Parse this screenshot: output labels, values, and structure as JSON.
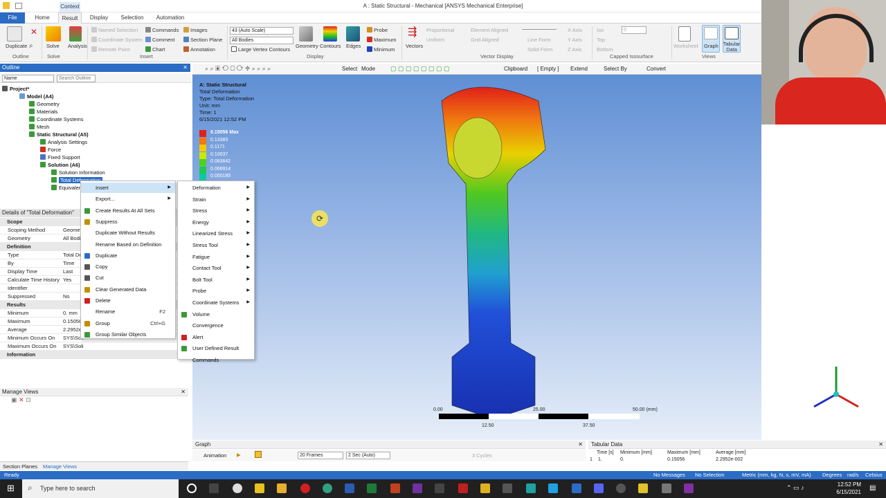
{
  "window": {
    "title": "A : Static Structural - Mechanical [ANSYS Mechanical Enterprise]",
    "context_tab": "Context"
  },
  "tabs": [
    "File",
    "Home",
    "Result",
    "Display",
    "Selection",
    "Automation"
  ],
  "ribbon": {
    "outline": {
      "duplicate": "Duplicate",
      "label": "Outline"
    },
    "solve": {
      "solve": "Solve",
      "analysis": "Analysis",
      "label": "Solve"
    },
    "insert": {
      "named_selection": "Named Selection",
      "coordinate_system": "Coordinate System",
      "remote_point": "Remote Point",
      "commands": "Commands",
      "comment": "Comment",
      "chart": "Chart",
      "images": "Images",
      "section_plane": "Section Plane",
      "annotation": "Annotation",
      "label": "Insert"
    },
    "display": {
      "scale": "43 (Auto Scale)",
      "bodies": "All Bodies",
      "large_vertex": "Large Vertex Contours",
      "geometry": "Geometry",
      "contours": "Contours",
      "edges": "Edges",
      "probe": "Probe",
      "maximum": "Maximum",
      "minimum": "Minimum",
      "label": "Display"
    },
    "vector": {
      "vectors": "Vectors",
      "proportional": "Proportional",
      "uniform": "Uniform",
      "element_aligned": "Element Aligned",
      "grid_aligned": "Grid Aligned",
      "line_form": "Line Form",
      "solid_form": "Solid Form",
      "x_axis": "X Axis",
      "y_axis": "Y Axis",
      "z_axis": "Z Axis",
      "label": "Vector Display"
    },
    "capped": {
      "iso": "Iso",
      "top": "Top",
      "bottom": "Bottom",
      "value": "0",
      "label": "Capped Isosurface"
    },
    "views": {
      "worksheet": "Worksheet",
      "graph": "Graph",
      "tabular": "Tabular Data",
      "label": "Views"
    }
  },
  "outline": {
    "title": "Outline",
    "name_label": "Name",
    "search_placeholder": "Search Outline",
    "items": [
      "Project*",
      "Model (A4)",
      "Geometry",
      "Materials",
      "Coordinate Systems",
      "Mesh",
      "Static Structural (A5)",
      "Analysis Settings",
      "Force",
      "Fixed Support",
      "Solution (A6)",
      "Solution Information",
      "Total Deformation",
      "Equivalent"
    ]
  },
  "details": {
    "title": "Details of \"Total Deformation\"",
    "rows": [
      {
        "k": "Scope",
        "v": "",
        "sec": true
      },
      {
        "k": "Scoping Method",
        "v": "Geometry Selection"
      },
      {
        "k": "Geometry",
        "v": "All Bodies"
      },
      {
        "k": "Definition",
        "v": "",
        "sec": true
      },
      {
        "k": "Type",
        "v": "Total Deformation"
      },
      {
        "k": "By",
        "v": "Time"
      },
      {
        "k": "Display Time",
        "v": "Last"
      },
      {
        "k": "Calculate Time History",
        "v": "Yes"
      },
      {
        "k": "Identifier",
        "v": ""
      },
      {
        "k": "Suppressed",
        "v": "No"
      },
      {
        "k": "Results",
        "v": "",
        "sec": true
      },
      {
        "k": "Minimum",
        "v": "0. mm"
      },
      {
        "k": "Maximum",
        "v": "0.15056 mm"
      },
      {
        "k": "Average",
        "v": "2.2952e-002 mm"
      },
      {
        "k": "Minimum Occurs On",
        "v": "SYS\\Solid"
      },
      {
        "k": "Maximum Occurs On",
        "v": "SYS\\Solid"
      },
      {
        "k": "Information",
        "v": "",
        "sec": true
      }
    ]
  },
  "manage_views": {
    "title": "Manage Views"
  },
  "bottom_tabs": [
    "Section Planes",
    "Manage Views"
  ],
  "context_menu": [
    {
      "label": "Insert",
      "sub": true
    },
    {
      "label": "Export...",
      "sub": true
    },
    {
      "label": "Create Results At All Sets"
    },
    {
      "label": "Suppress"
    },
    {
      "label": "Duplicate Without Results"
    },
    {
      "label": "Rename Based on Definition"
    },
    {
      "label": "Duplicate"
    },
    {
      "label": "Copy"
    },
    {
      "label": "Cut"
    },
    {
      "label": "Clear Generated Data"
    },
    {
      "label": "Delete"
    },
    {
      "label": "Rename",
      "shortcut": "F2"
    },
    {
      "label": "Group",
      "shortcut": "Ctrl+G"
    },
    {
      "label": "Group Similar Objects"
    }
  ],
  "submenu": [
    {
      "label": "Deformation",
      "sub": true
    },
    {
      "label": "Strain",
      "sub": true
    },
    {
      "label": "Stress",
      "sub": true
    },
    {
      "label": "Energy",
      "sub": true
    },
    {
      "label": "Linearized Stress",
      "sub": true
    },
    {
      "label": "Stress Tool",
      "sub": true
    },
    {
      "label": "Fatigue",
      "sub": true
    },
    {
      "label": "Contact Tool",
      "sub": true
    },
    {
      "label": "Bolt Tool",
      "sub": true
    },
    {
      "label": "Probe",
      "sub": true
    },
    {
      "label": "Coordinate Systems",
      "sub": true
    },
    {
      "label": "Volume"
    },
    {
      "label": "Convergence"
    },
    {
      "label": "Alert"
    },
    {
      "label": "User Defined Result"
    },
    {
      "label": "Commands"
    }
  ],
  "graphics_toolbar": {
    "select": "Select",
    "mode": "Mode",
    "clipboard": "Clipboard",
    "empty": "[ Empty ]",
    "extend": "Extend",
    "select_by": "Select By",
    "convert": "Convert"
  },
  "result_info": {
    "lines": [
      "A: Static Structural",
      "Total Deformation",
      "Type: Total Deformation",
      "Unit: mm",
      "Time: 1",
      "6/15/2021 12:52 PM"
    ]
  },
  "legend": {
    "values": [
      "0.15056 Max",
      "0.13383",
      "0.1171",
      "0.10037",
      "0.083642",
      "0.066914",
      "0.050185"
    ],
    "colors": [
      "#e0201a",
      "#f07a10",
      "#f5c800",
      "#c8e800",
      "#50d020",
      "#20c850",
      "#10c8a0"
    ]
  },
  "scale_bar": {
    "ticks": [
      "0.00",
      "25.00",
      "50.00 (mm)",
      "12.50",
      "37.50"
    ]
  },
  "graph": {
    "title": "Graph",
    "animation": "Animation",
    "frames": "20 Frames",
    "duration": "2 Sec (Auto)",
    "cycles": "3 Cycles"
  },
  "tabular": {
    "title": "Tabular Data",
    "headers": [
      "Time [s]",
      "Minimum [mm]",
      "Maximum [mm]",
      "Average [mm]"
    ],
    "row": [
      "1",
      "1.",
      "0.",
      "0.15056",
      "2.2952e-002"
    ]
  },
  "status": {
    "ready": "Ready",
    "messages": "No Messages",
    "selection": "No Selection",
    "units": "Metric (mm, kg, N, s, mV, mA)",
    "degrees": "Degrees",
    "rad": "rad/s",
    "celsius": "Celsius"
  },
  "taskbar": {
    "search": "Type here to search",
    "time": "12:52 PM",
    "date": "6/15/2021"
  }
}
